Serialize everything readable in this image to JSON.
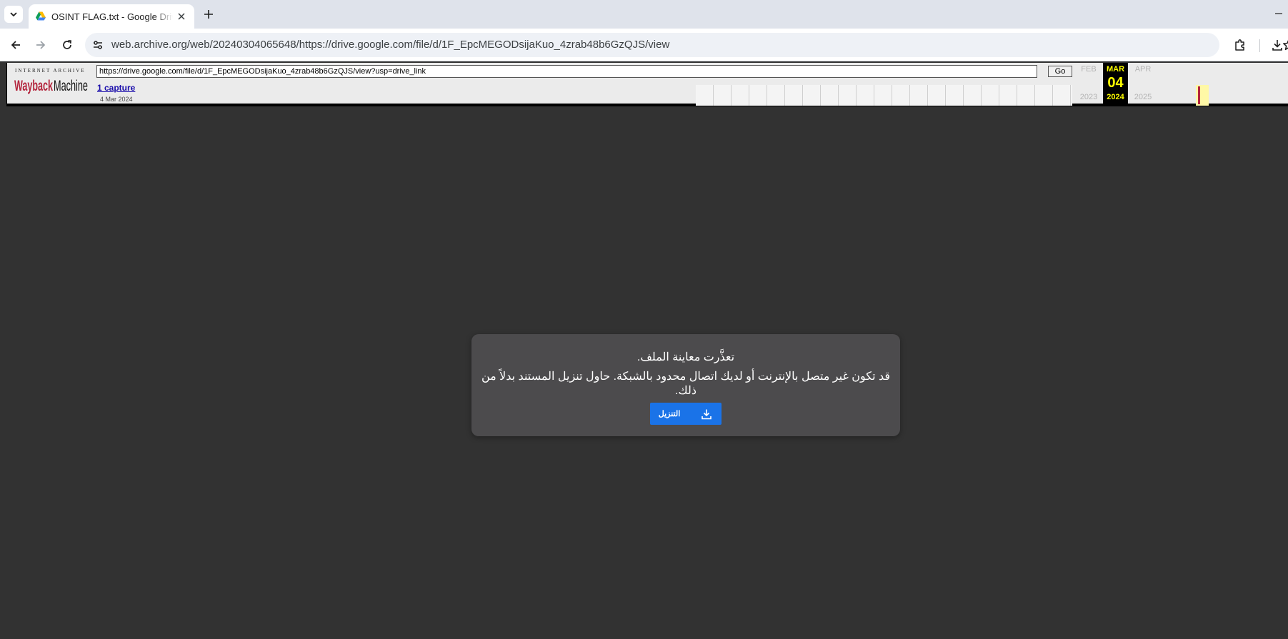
{
  "browser": {
    "tab": {
      "title": "OSINT FLAG.txt - Google Drive",
      "favicon": "google-drive-icon"
    },
    "address_bar": {
      "url": "web.archive.org/web/20240304065648/https://drive.google.com/file/d/1F_EpcMEGODsijaKuo_4zrab48b6GzQJS/view"
    },
    "icons": {
      "tab_search": "chevron-down-icon",
      "new_tab": "plus-icon",
      "back": "back-arrow-icon",
      "forward": "forward-arrow-icon",
      "reload": "reload-icon",
      "site_info": "tune-icon",
      "bookmark": "star-icon",
      "extensions": "puzzle-icon",
      "downloads": "download-icon",
      "minimize": "minimize-icon"
    }
  },
  "wayback": {
    "logo_top": "INTERNET ARCHIVE",
    "logo_wayback": "Wayback",
    "logo_machine": "Machine",
    "url_input": "https://drive.google.com/file/d/1F_EpcMEGODsijaKuo_4zrab48b6GzQJS/view?usp=drive_link",
    "go_label": "Go",
    "captures_label": "1 capture",
    "capture_date": "4 Mar 2024",
    "calendar": {
      "prev": {
        "month": "FEB",
        "year": "2023"
      },
      "current": {
        "month": "MAR",
        "day": "04",
        "year": "2024"
      },
      "next": {
        "month": "APR",
        "year": "2025"
      }
    },
    "colors": {
      "active_bg": "#000000",
      "active_text": "#ffff00",
      "capture_mark": "#b3243c"
    }
  },
  "drive": {
    "error_title": "تعذَّرت معاينة الملف.",
    "error_message": "قد تكون غير متصل بالإنترنت أو لديك اتصال محدود بالشبكة. حاول تنزيل المستند بدلاً من ذلك.",
    "download_button": "التنزيل",
    "accent": "#1a73e8"
  }
}
